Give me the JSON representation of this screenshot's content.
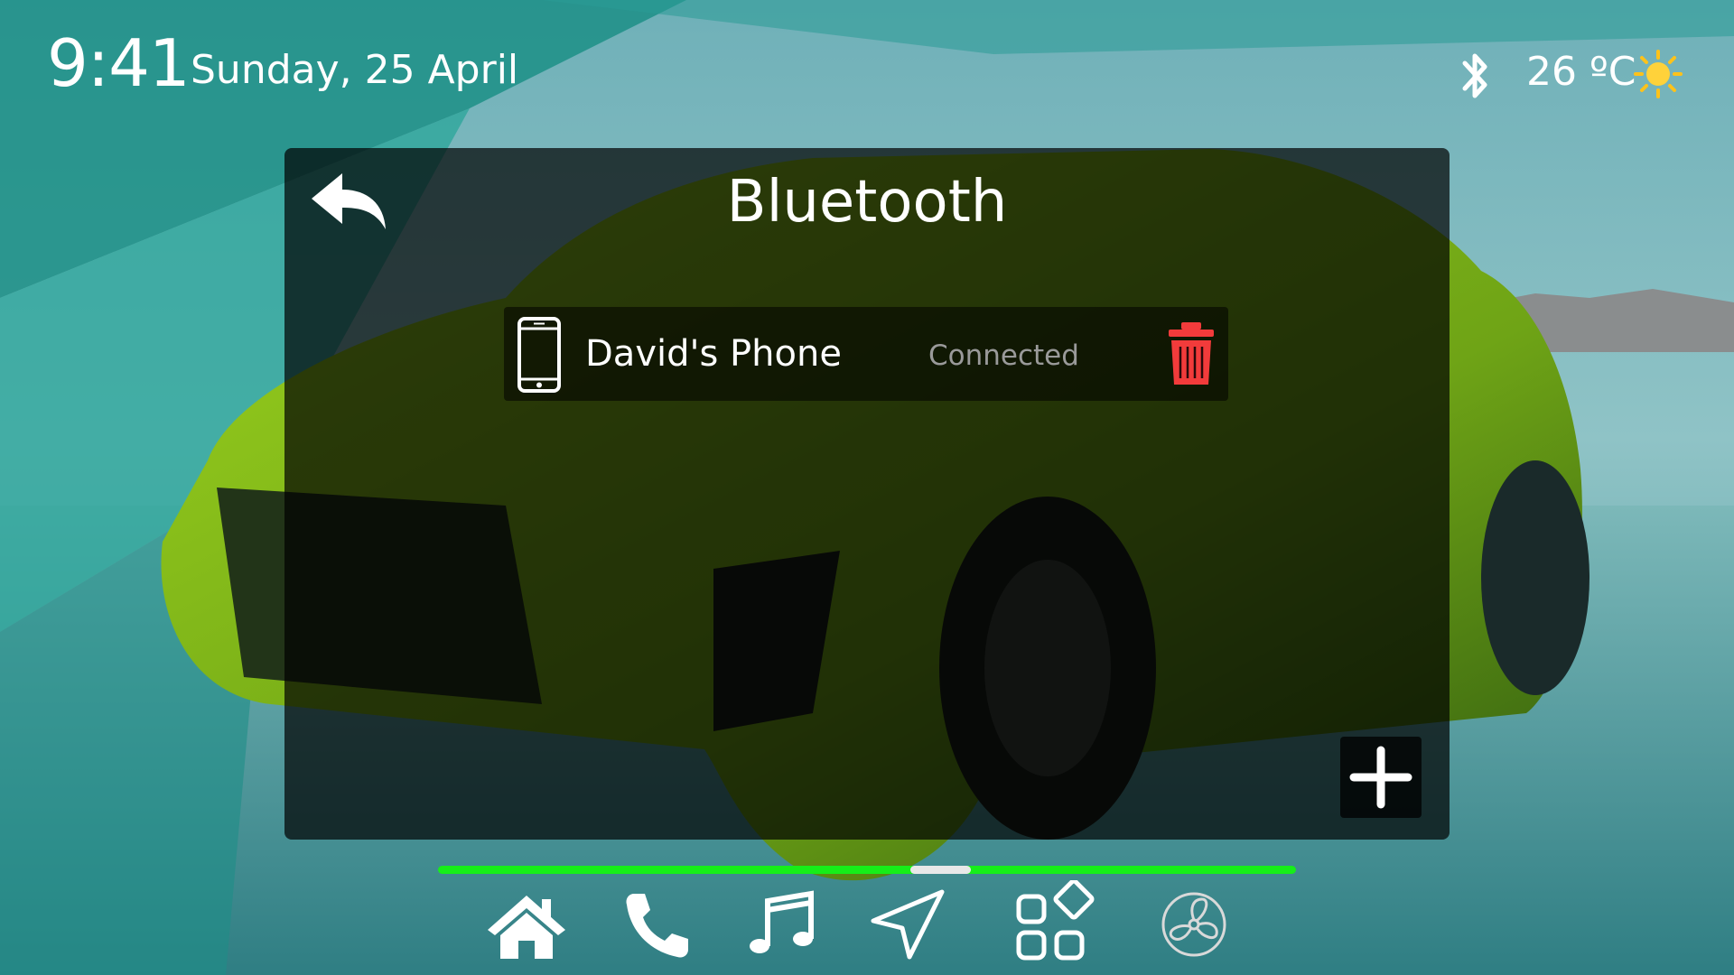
{
  "status_bar": {
    "time": "9:41",
    "date": "Sunday, 25 April",
    "temperature": "26 ºC",
    "bluetooth_icon": "bluetooth-icon",
    "weather_icon": "sun-icon"
  },
  "bluetooth_panel": {
    "title": "Bluetooth",
    "back_icon": "reply-arrow-icon",
    "devices": [
      {
        "name": "David's Phone",
        "status": "Connected",
        "icon": "smartphone-icon",
        "action_icon": "trash-icon"
      }
    ],
    "add_icon": "plus-icon"
  },
  "nav": {
    "page_indicator": {
      "position_fraction": 0.55,
      "thumb_fraction": 0.07
    },
    "items": [
      {
        "id": "home",
        "icon": "home-icon"
      },
      {
        "id": "phone",
        "icon": "phone-icon"
      },
      {
        "id": "music",
        "icon": "music-note-icon"
      },
      {
        "id": "navigation",
        "icon": "navigation-arrow-icon"
      },
      {
        "id": "apps",
        "icon": "apps-grid-icon",
        "active": true
      },
      {
        "id": "climate",
        "icon": "fan-icon"
      }
    ]
  },
  "colors": {
    "accent_green": "#16ee19",
    "delete_red": "#f23b3b",
    "muted_text": "#9a9a9a"
  }
}
